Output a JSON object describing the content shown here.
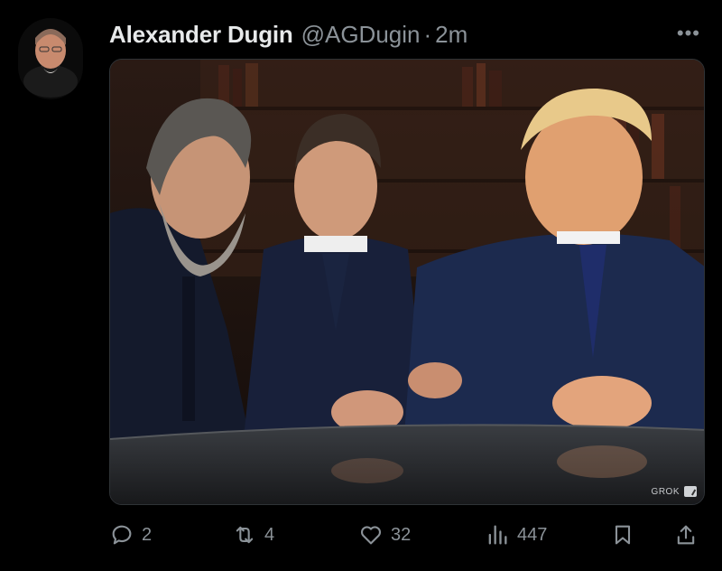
{
  "tweet": {
    "display_name": "Alexander Dugin",
    "handle": "@AGDugin",
    "separator": "·",
    "time": "2m",
    "more_label": "•••"
  },
  "media": {
    "watermark": "GROK"
  },
  "actions": {
    "replies": "2",
    "retweets": "4",
    "likes": "32",
    "views": "447"
  },
  "colors": {
    "background": "#000000",
    "text_primary": "#e7e9ea",
    "text_secondary": "#8b9298"
  },
  "icons": [
    "more-icon",
    "reply-icon",
    "retweet-icon",
    "like-icon",
    "views-icon",
    "bookmark-icon",
    "share-icon"
  ]
}
